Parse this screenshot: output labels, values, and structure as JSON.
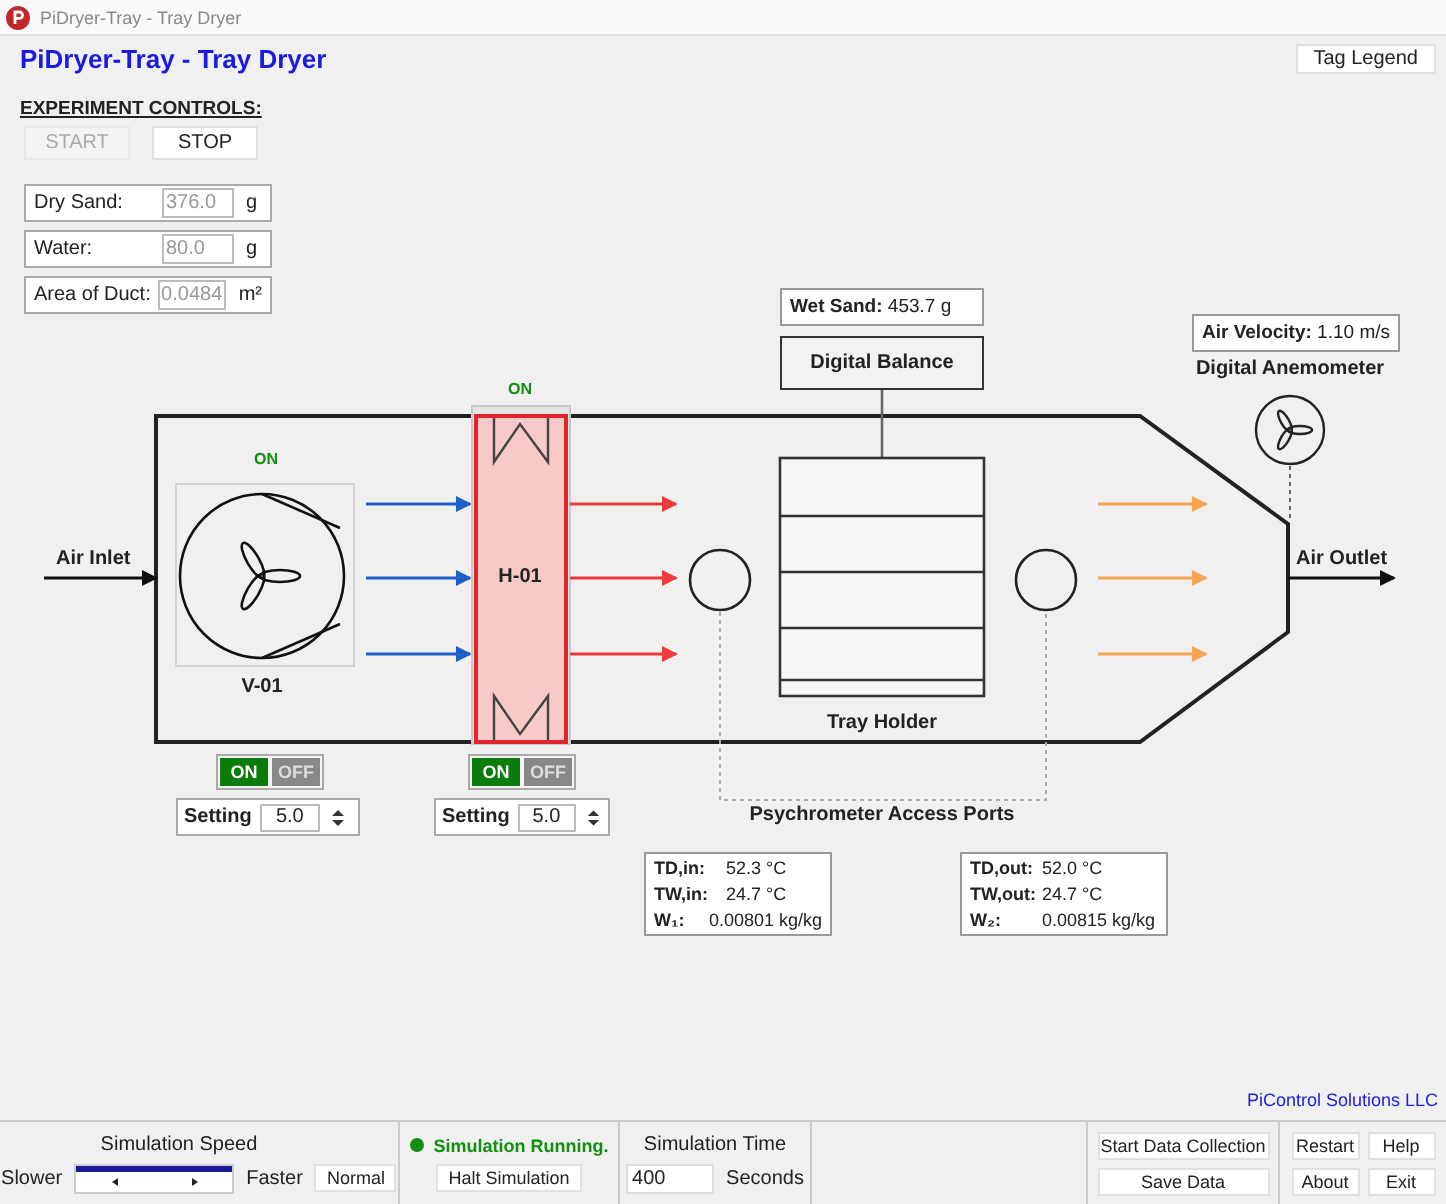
{
  "title_bar": {
    "title": "PiDryer-Tray - Tray Dryer"
  },
  "header": {
    "title": "PiDryer-Tray - Tray Dryer",
    "tag_legend_button": "Tag Legend"
  },
  "experiment_controls": {
    "heading": "EXPERIMENT CONTROLS:",
    "buttons": [
      {
        "label": "START",
        "disabled": true
      },
      {
        "label": "STOP",
        "disabled": false
      }
    ],
    "fields": [
      {
        "label": "Dry Sand:",
        "value": "376.0",
        "unit": "g",
        "disabled": true
      },
      {
        "label": "Water:",
        "value": "80.0",
        "unit": "g",
        "disabled": true
      },
      {
        "label": "Area of Duct:",
        "value": "0.0484",
        "unit": "m²",
        "disabled": true
      }
    ]
  },
  "diagram": {
    "inlet_label": "Air Inlet",
    "outlet_label": "Air Outlet",
    "fan": {
      "tag": "V-01",
      "status": "ON",
      "running": true,
      "toggle": [
        {
          "label": "ON",
          "selected": true
        },
        {
          "label": "OFF",
          "selected": false
        }
      ],
      "setting_label": "Setting",
      "setting": "5.0"
    },
    "heater": {
      "tag": "H-01",
      "status": "ON",
      "running": true,
      "toggle": [
        {
          "label": "ON",
          "selected": true
        },
        {
          "label": "OFF",
          "selected": false
        }
      ],
      "setting_label": "Setting",
      "setting": "5.0"
    },
    "balance": {
      "reading_label": "Wet Sand:",
      "reading": "453.7 g",
      "name": "Digital Balance"
    },
    "tray_holder": {
      "label": "Tray Holder"
    },
    "anemometer": {
      "reading_label": "Air Velocity:",
      "reading": "1.10 m/s",
      "name": "Digital Anemometer"
    },
    "ports_label": "Psychrometer Access Ports",
    "psychrometers": [
      {
        "rows": [
          {
            "label": "TD,in:",
            "value": "52.3 °C"
          },
          {
            "label": "TW,in:",
            "value": "24.7 °C"
          },
          {
            "label": "W₁:",
            "value": "0.00801 kg/kg"
          }
        ]
      },
      {
        "rows": [
          {
            "label": "TD,out:",
            "value": "52.0 °C"
          },
          {
            "label": "TW,out:",
            "value": "24.7 °C"
          },
          {
            "label": "W₂:",
            "value": "0.00815 kg/kg"
          }
        ]
      }
    ]
  },
  "footer": {
    "company": "PiControl Solutions LLC"
  },
  "status_bar": {
    "speed": {
      "label": "Simulation Speed",
      "level": 1,
      "slower": "Slower",
      "faster": "Faster",
      "normal_button": "Normal"
    },
    "status": {
      "text": "Simulation Running.",
      "running": true,
      "halt_button": "Halt Simulation"
    },
    "time": {
      "label": "Simulation Time",
      "value": "400",
      "unit": "Seconds"
    },
    "data_buttons": [
      "Start Data Collection",
      "Save Data"
    ],
    "app_buttons": [
      "Restart",
      "Help",
      "About",
      "Exit"
    ]
  }
}
